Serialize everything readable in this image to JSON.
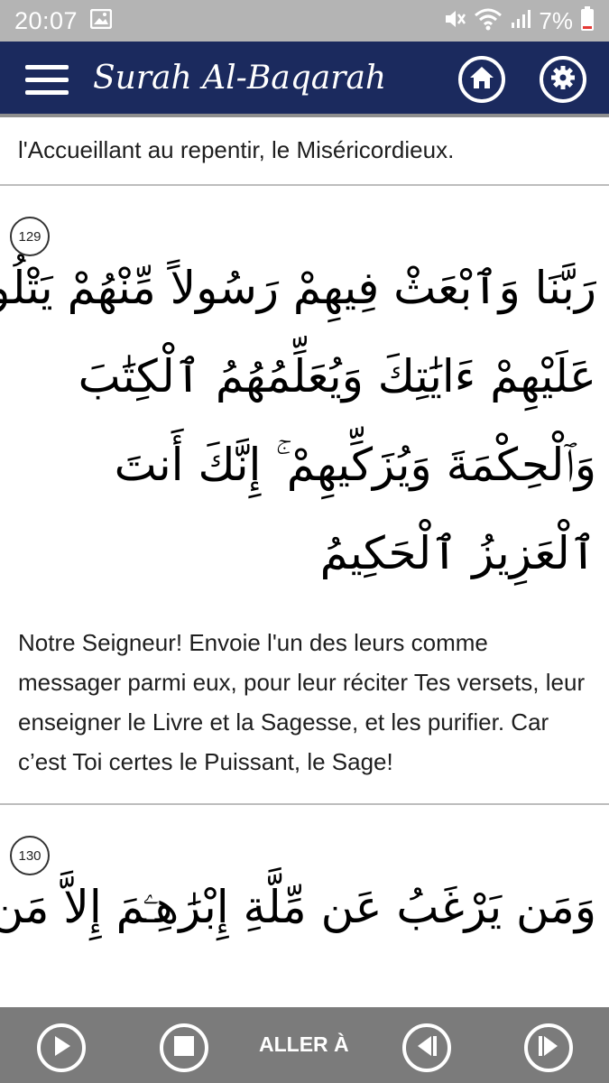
{
  "status_bar": {
    "time": "20:07",
    "battery_percent": "7%",
    "icons": [
      "image-icon",
      "mute-icon",
      "wifi-icon",
      "signal-icon",
      "battery-icon"
    ]
  },
  "app_bar": {
    "title": "Surah Al-Baqarah",
    "color": "#1b2a5e",
    "icons": [
      "menu-icon",
      "home-icon",
      "settings-icon"
    ]
  },
  "content": {
    "previous_translation": "l'Accueillant au repentir, le Miséricordieux.",
    "verses": [
      {
        "number": "129",
        "arabic_lines": [
          "رَبَّنَا وَٱبْعَثْ فِيهِمْ رَسُولاً مِّنْهُمْ يَتْلُواْ",
          "عَلَيْهِمْ ءَايَٰتِكَ وَيُعَلِّمُهُمُ ٱلْكِتَٰبَ",
          "وَٱلْحِكْمَةَ وَيُزَكِّيهِمْ ۚ إِنَّكَ أَنتَ",
          "ٱلْعَزِيزُ ٱلْحَكِيمُ"
        ],
        "translation": "Notre Seigneur! Envoie l'un des leurs comme messager parmi eux, pour leur réciter Tes versets, leur enseigner le Livre et la Sagesse, et les purifier. Car c’est Toi certes le Puissant, le Sage!"
      },
      {
        "number": "130",
        "arabic_lines": [
          "وَمَن يَرْغَبُ عَن مِّلَّةِ إِبْرَٰهِـۧمَ إِلاَّ مَن"
        ]
      }
    ]
  },
  "bottom_bar": {
    "goto_label": "ALLER À",
    "color": "#7b7b7b",
    "icons": [
      "play-icon",
      "stop-icon",
      "previous-icon",
      "next-icon"
    ]
  }
}
